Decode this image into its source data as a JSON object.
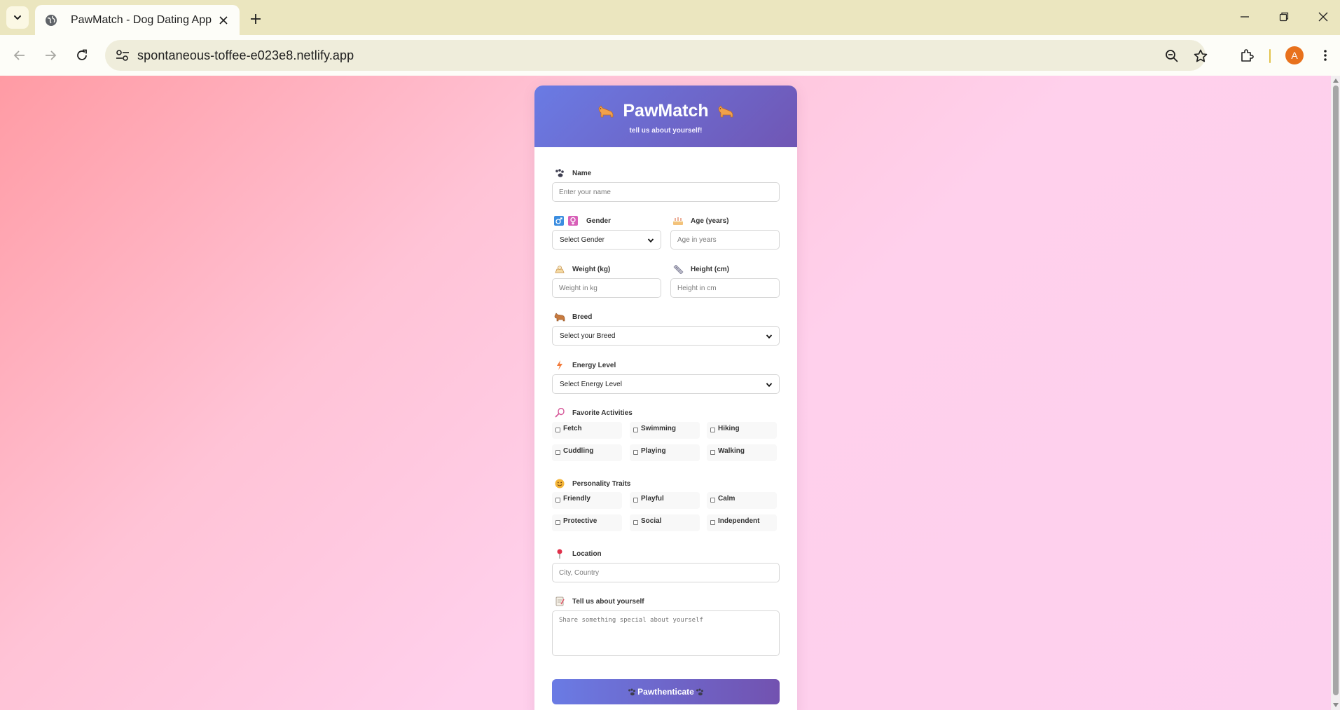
{
  "browser": {
    "tab_title": "PawMatch - Dog Dating App",
    "url": "spontaneous-toffee-e023e8.netlify.app",
    "profile_initial": "A"
  },
  "app": {
    "brand": "PawMatch",
    "subtitle": "tell us about yourself!",
    "accent_colors": {
      "header_start": "#6a7be4",
      "header_end": "#7056b4"
    }
  },
  "form": {
    "name": {
      "label": "Name",
      "placeholder": "Enter your name"
    },
    "gender": {
      "label": "Gender",
      "selected": "Select Gender"
    },
    "age": {
      "label": "Age (years)",
      "placeholder": "Age in years"
    },
    "weight": {
      "label": "Weight (kg)",
      "placeholder": "Weight in kg"
    },
    "height": {
      "label": "Height (cm)",
      "placeholder": "Height in cm"
    },
    "breed": {
      "label": "Breed",
      "selected": "Select your Breed"
    },
    "energy": {
      "label": "Energy Level",
      "selected": "Select Energy Level"
    },
    "activities": {
      "label": "Favorite Activities",
      "options": [
        "Fetch",
        "Swimming",
        "Hiking",
        "Cuddling",
        "Playing",
        "Walking"
      ]
    },
    "traits": {
      "label": "Personality Traits",
      "options": [
        "Friendly",
        "Playful",
        "Calm",
        "Protective",
        "Social",
        "Independent"
      ]
    },
    "location": {
      "label": "Location",
      "placeholder": "City, Country"
    },
    "about": {
      "label": "Tell us about yourself",
      "placeholder": "Share something special about yourself"
    },
    "submit_label": "Pawthenticate"
  }
}
